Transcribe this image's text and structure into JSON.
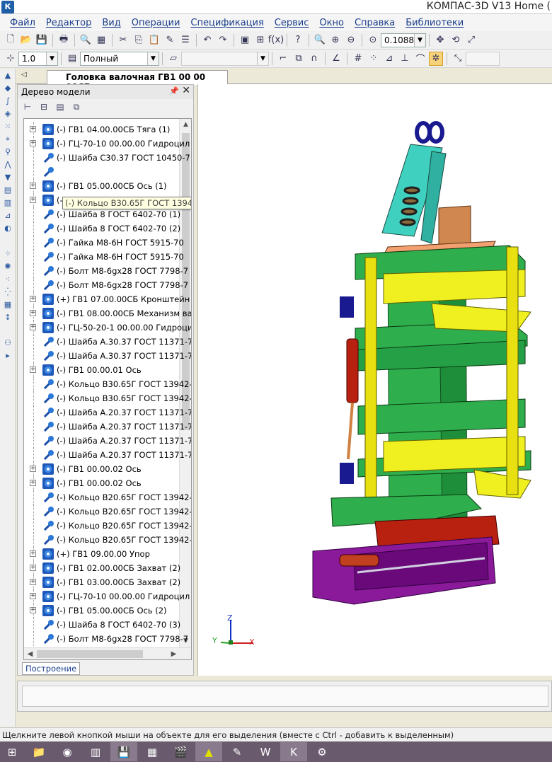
{
  "window": {
    "title": "КОМПАС-3D V13 Home (",
    "app_icon": "К"
  },
  "menu": [
    "Файл",
    "Редактор",
    "Вид",
    "Операции",
    "Спецификация",
    "Сервис",
    "Окно",
    "Справка",
    "Библиотеки"
  ],
  "toolbar_top": {
    "zoom_value": "0.1088"
  },
  "toolbar_second": {
    "step_value": "1.0",
    "render_mode": "Полный",
    "disabled_field": ""
  },
  "document_tab": "Головка валочная ГВ1 00 00 00СБ",
  "tree_panel": {
    "title": "Дерево модели",
    "bottom_tab": "Построение",
    "tooltip": "(-) Кольцо В30.65Г ГОСТ 13942-86 (1)",
    "items": [
      {
        "label": "(-) ГВ1 04.00.00СБ Тяга (1)",
        "icon": "assembly",
        "expandable": true
      },
      {
        "label": "(-) ГЦ-70-10 00.00.00 Гидроцил",
        "icon": "assembly",
        "expandable": true
      },
      {
        "label": "(-) Шайба С30.37 ГОСТ 10450-7",
        "icon": "part",
        "expandable": false
      },
      {
        "label": "",
        "icon": "part",
        "expandable": false
      },
      {
        "label": "(-) ГВ1 05.00.00СБ Ось (1)",
        "icon": "assembly",
        "expandable": true
      },
      {
        "label": "(-) ГВ1 05.00.00СБ Ось (1)",
        "icon": "assembly",
        "expandable": true
      },
      {
        "label": "(-) Шайба 8 ГОСТ 6402-70 (1)",
        "icon": "part",
        "expandable": false
      },
      {
        "label": "(-) Шайба 8 ГОСТ 6402-70 (2)",
        "icon": "part",
        "expandable": false
      },
      {
        "label": "(-) Гайка М8-6Н ГОСТ 5915-70",
        "icon": "part",
        "expandable": false
      },
      {
        "label": "(-) Гайка М8-6Н ГОСТ 5915-70",
        "icon": "part",
        "expandable": false
      },
      {
        "label": "(-) Болт М8-6gx28 ГОСТ 7798-7",
        "icon": "part",
        "expandable": false
      },
      {
        "label": "(-) Болт М8-6gx28 ГОСТ 7798-7",
        "icon": "part",
        "expandable": false
      },
      {
        "label": "(+) ГВ1 07.00.00СБ Кронштейн",
        "icon": "assembly",
        "expandable": true
      },
      {
        "label": "(-) ГВ1 08.00.00СБ Механизм ва",
        "icon": "assembly",
        "expandable": true
      },
      {
        "label": "(-) ГЦ-50-20-1 00.00.00 Гидроци",
        "icon": "assembly",
        "expandable": true
      },
      {
        "label": "(-) Шайба А.30.37 ГОСТ 11371-7",
        "icon": "part",
        "expandable": false
      },
      {
        "label": "(-) Шайба А.30.37 ГОСТ 11371-7",
        "icon": "part",
        "expandable": false
      },
      {
        "label": "(-) ГВ1 00.00.01 Ось",
        "icon": "assembly",
        "expandable": true
      },
      {
        "label": "(-) Кольцо В30.65Г ГОСТ 13942-",
        "icon": "part",
        "expandable": false
      },
      {
        "label": "(-) Кольцо В30.65Г ГОСТ 13942-",
        "icon": "part",
        "expandable": false
      },
      {
        "label": "(-) Шайба А.20.37 ГОСТ 11371-7",
        "icon": "part",
        "expandable": false
      },
      {
        "label": "(-) Шайба А.20.37 ГОСТ 11371-7",
        "icon": "part",
        "expandable": false
      },
      {
        "label": "(-) Шайба А.20.37 ГОСТ 11371-7",
        "icon": "part",
        "expandable": false
      },
      {
        "label": "(-) Шайба А.20.37 ГОСТ 11371-7",
        "icon": "part",
        "expandable": false
      },
      {
        "label": "(-) ГВ1 00.00.02 Ось",
        "icon": "assembly",
        "expandable": true
      },
      {
        "label": "(-) ГВ1 00.00.02 Ось",
        "icon": "assembly",
        "expandable": true
      },
      {
        "label": "(-) Кольцо В20.65Г ГОСТ 13942-",
        "icon": "part",
        "expandable": false
      },
      {
        "label": "(-) Кольцо В20.65Г ГОСТ 13942-",
        "icon": "part",
        "expandable": false
      },
      {
        "label": "(-) Кольцо В20.65Г ГОСТ 13942-",
        "icon": "part",
        "expandable": false
      },
      {
        "label": "(-) Кольцо В20.65Г ГОСТ 13942-",
        "icon": "part",
        "expandable": false
      },
      {
        "label": "(+) ГВ1 09.00.00 Упор",
        "icon": "assembly",
        "expandable": true
      },
      {
        "label": "(-) ГВ1 02.00.00СБ Захват (2)",
        "icon": "assembly",
        "expandable": true
      },
      {
        "label": "(-) ГВ1 03.00.00СБ Захват (2)",
        "icon": "assembly",
        "expandable": true
      },
      {
        "label": "(-) ГЦ-70-10 00.00.00 Гидроцил",
        "icon": "assembly",
        "expandable": true
      },
      {
        "label": "(-) ГВ1 05.00.00СБ Ось (2)",
        "icon": "assembly",
        "expandable": true
      },
      {
        "label": "(-) Шайба 8 ГОСТ 6402-70 (3)",
        "icon": "part",
        "expandable": false
      },
      {
        "label": "(-) Болт М8-6gx28 ГОСТ 7798-7",
        "icon": "part",
        "expandable": false
      }
    ]
  },
  "axes": {
    "x": "X",
    "y": "Y",
    "z": "Z"
  },
  "colors": {
    "green": "#2fae4e",
    "yellow": "#f0f020",
    "cyan": "#3fd0c0",
    "purple": "#8a1a9a",
    "red": "#b82010",
    "navy": "#1a1a90",
    "orange": "#d08850"
  },
  "status": "Щелкните левой кнопкой мыши на объекте для его выделения (вместе с Ctrl - добавить к выделенным)"
}
